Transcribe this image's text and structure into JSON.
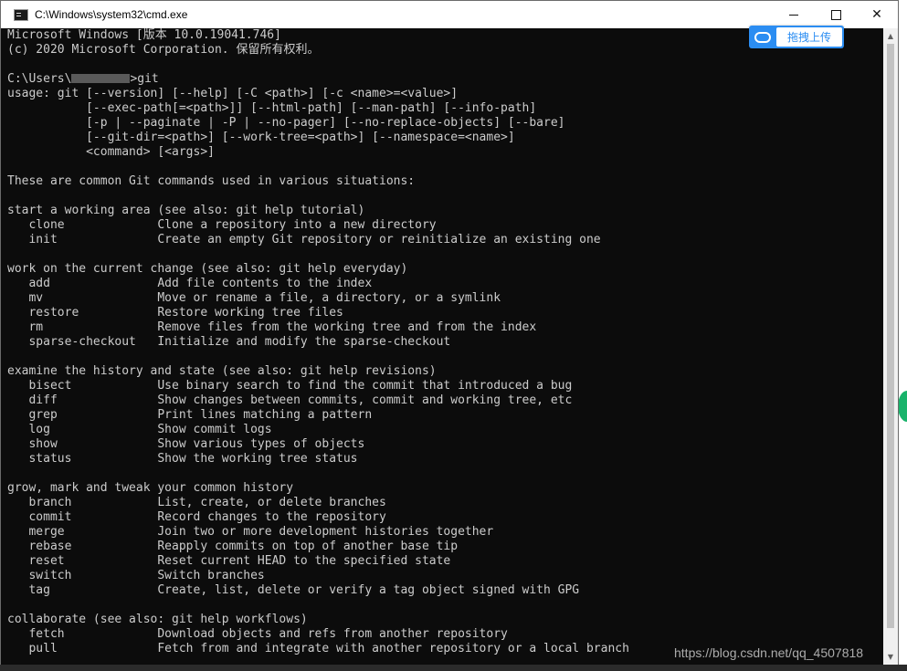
{
  "window": {
    "title": "C:\\Windows\\system32\\cmd.exe",
    "controls": {
      "minimize": "minimize",
      "maximize": "maximize",
      "close": "✕"
    }
  },
  "upload_badge": {
    "label": "拖拽上传"
  },
  "console": {
    "lines": [
      "Microsoft Windows [版本 10.0.19041.746]",
      "(c) 2020 Microsoft Corporation. 保留所有权利。",
      "",
      {
        "prefix": "C:\\Users\\",
        "redacted": true,
        "suffix": ">git"
      },
      "usage: git [--version] [--help] [-C <path>] [-c <name>=<value>]",
      "           [--exec-path[=<path>]] [--html-path] [--man-path] [--info-path]",
      "           [-p | --paginate | -P | --no-pager] [--no-replace-objects] [--bare]",
      "           [--git-dir=<path>] [--work-tree=<path>] [--namespace=<name>]",
      "           <command> [<args>]",
      "",
      "These are common Git commands used in various situations:",
      "",
      "start a working area (see also: git help tutorial)",
      "   clone             Clone a repository into a new directory",
      "   init              Create an empty Git repository or reinitialize an existing one",
      "",
      "work on the current change (see also: git help everyday)",
      "   add               Add file contents to the index",
      "   mv                Move or rename a file, a directory, or a symlink",
      "   restore           Restore working tree files",
      "   rm                Remove files from the working tree and from the index",
      "   sparse-checkout   Initialize and modify the sparse-checkout",
      "",
      "examine the history and state (see also: git help revisions)",
      "   bisect            Use binary search to find the commit that introduced a bug",
      "   diff              Show changes between commits, commit and working tree, etc",
      "   grep              Print lines matching a pattern",
      "   log               Show commit logs",
      "   show              Show various types of objects",
      "   status            Show the working tree status",
      "",
      "grow, mark and tweak your common history",
      "   branch            List, create, or delete branches",
      "   commit            Record changes to the repository",
      "   merge             Join two or more development histories together",
      "   rebase            Reapply commits on top of another base tip",
      "   reset             Reset current HEAD to the specified state",
      "   switch            Switch branches",
      "   tag               Create, list, delete or verify a tag object signed with GPG",
      "",
      "collaborate (see also: git help workflows)",
      "   fetch             Download objects and refs from another repository",
      "   pull              Fetch from and integrate with another repository or a local branch"
    ]
  },
  "watermark": "https://blog.csdn.net/qq_4507818",
  "colors": {
    "console_bg": "#0c0c0c",
    "console_fg": "#cccccc",
    "badge_blue": "#2b8df2"
  }
}
